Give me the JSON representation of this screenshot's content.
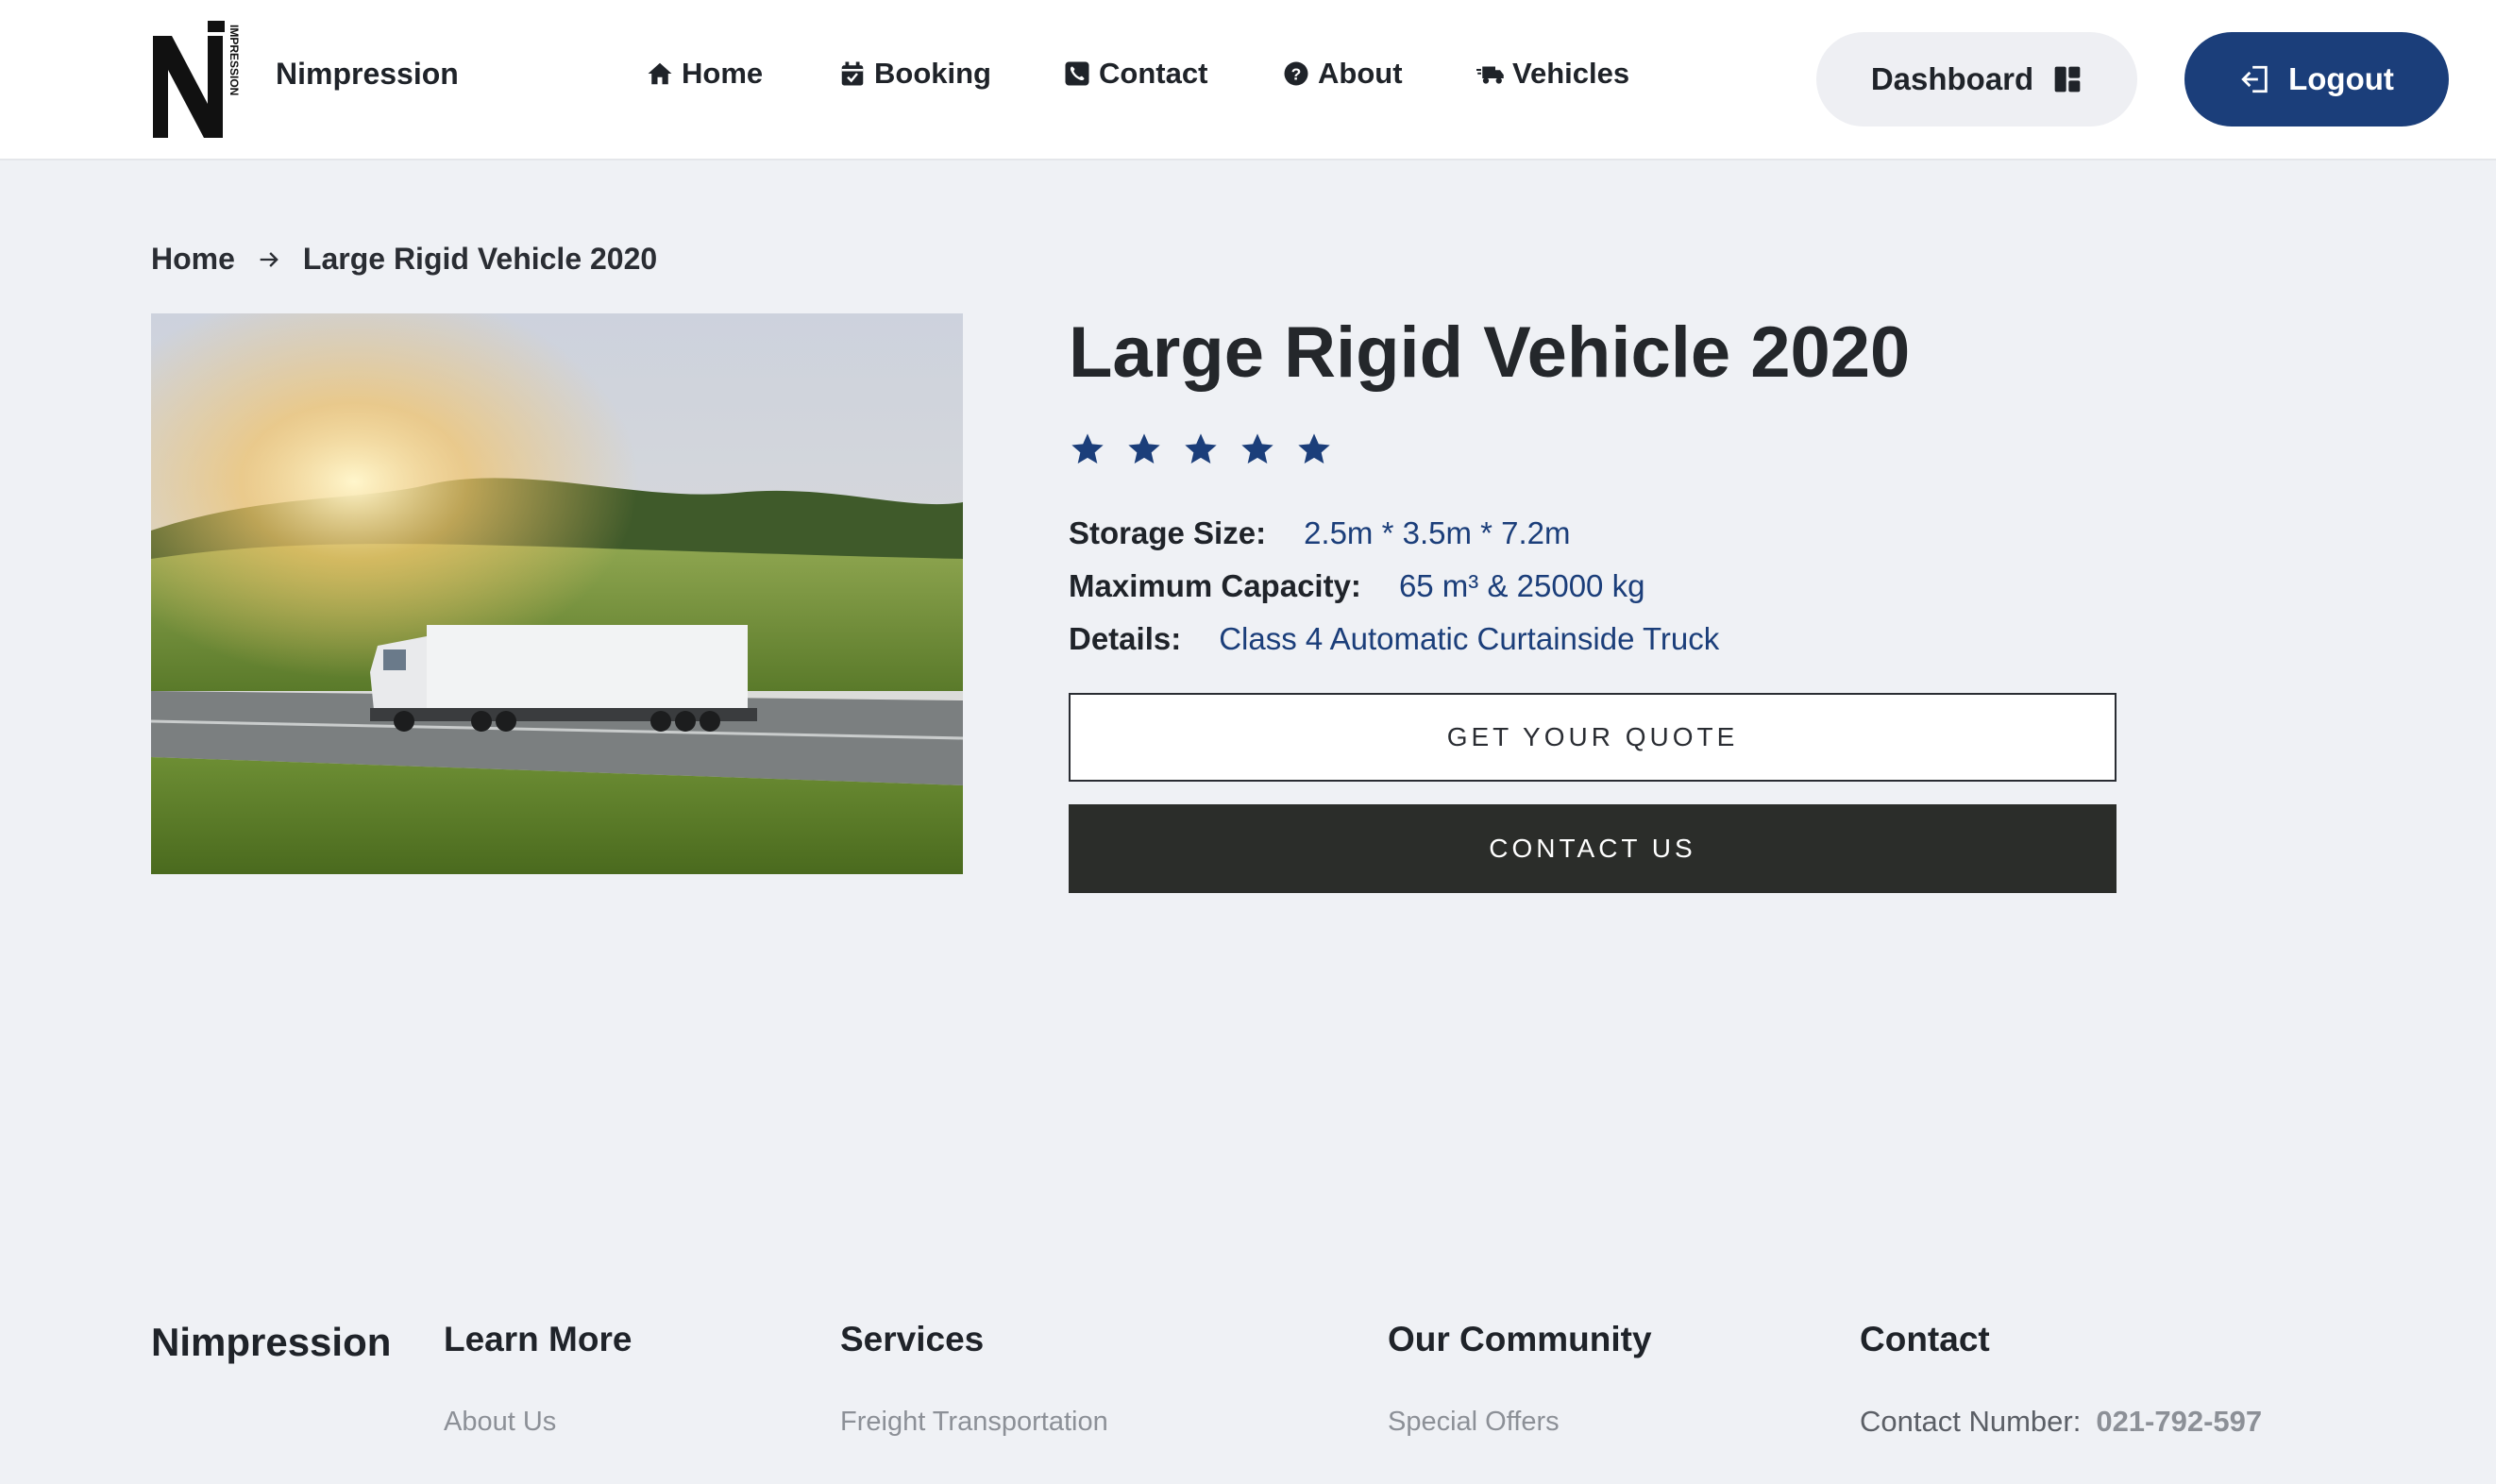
{
  "header": {
    "brand": "Nimpression",
    "logo_text": "IMPRESSION",
    "nav": [
      {
        "label": "Home",
        "icon": "home-icon"
      },
      {
        "label": "Booking",
        "icon": "calendar-check-icon"
      },
      {
        "label": "Contact",
        "icon": "phone-square-icon"
      },
      {
        "label": "About",
        "icon": "question-circle-icon"
      },
      {
        "label": "Vehicles",
        "icon": "truck-fast-icon"
      }
    ],
    "dashboard_label": "Dashboard",
    "dashboard_icon": "dashboard-layout-icon",
    "logout_label": "Logout",
    "logout_icon": "sign-out-icon"
  },
  "breadcrumb": {
    "home": "Home",
    "separator_icon": "arrow-right-icon",
    "current": "Large Rigid Vehicle 2020"
  },
  "vehicle": {
    "image_alt": "truck-photo",
    "title": "Large Rigid Vehicle 2020",
    "rating": 5,
    "rating_max": 5,
    "specs": [
      {
        "key": "Storage Size:",
        "value": "2.5m * 3.5m * 7.2m"
      },
      {
        "key": "Maximum Capacity:",
        "value": "65 m³ & 25000 kg"
      },
      {
        "key": "Details:",
        "value": "Class 4 Automatic Curtainside Truck"
      }
    ],
    "quote_button": "GET YOUR QUOTE",
    "contact_button": "CONTACT US"
  },
  "footer": {
    "brand": "Nimpression",
    "columns": [
      {
        "heading": "Learn More",
        "links": [
          "About Us"
        ]
      },
      {
        "heading": "Services",
        "links": [
          "Freight Transportation"
        ]
      },
      {
        "heading": "Our Community",
        "links": [
          "Special Offers"
        ]
      },
      {
        "heading": "Contact",
        "contact_label": "Contact Number:",
        "contact_value": "021-792-597"
      }
    ]
  },
  "colors": {
    "accent": "#1b3e7a",
    "background": "#eff1f5",
    "dark_button": "#2b2d2a"
  }
}
